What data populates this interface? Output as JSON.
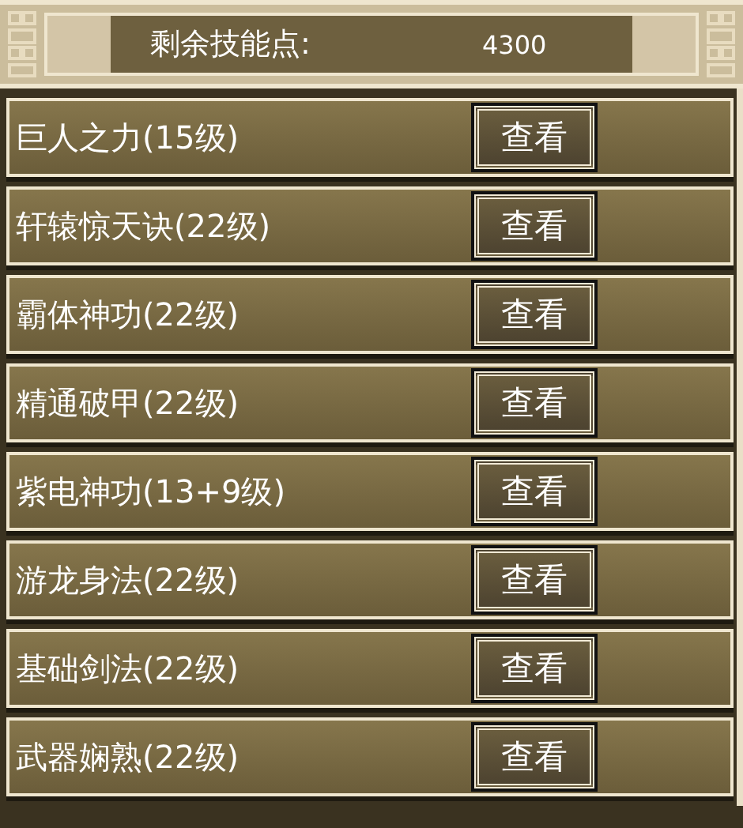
{
  "header": {
    "label": "剩余技能点:",
    "value": "4300"
  },
  "skills": [
    {
      "name": "巨人之力(15级)",
      "button": "查看"
    },
    {
      "name": "轩辕惊天诀(22级)",
      "button": "查看"
    },
    {
      "name": "霸体神功(22级)",
      "button": "查看"
    },
    {
      "name": "精通破甲(22级)",
      "button": "查看"
    },
    {
      "name": "紫电神功(13+9级)",
      "button": "查看"
    },
    {
      "name": "游龙身法(22级)",
      "button": "查看"
    },
    {
      "name": "基础剑法(22级)",
      "button": "查看"
    },
    {
      "name": "武器娴熟(22级)",
      "button": "查看"
    }
  ]
}
